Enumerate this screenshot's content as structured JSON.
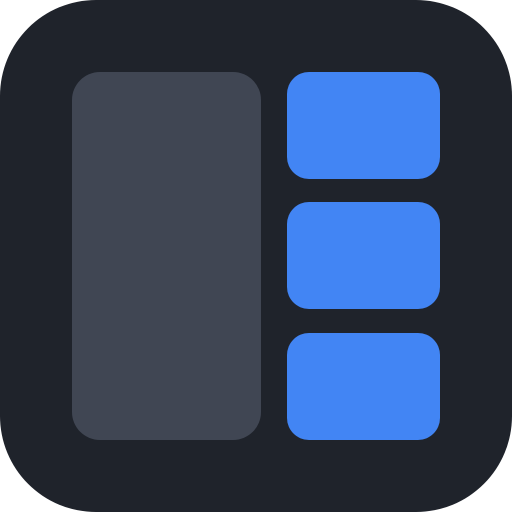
{
  "icon": {
    "name": "layout-panels-icon",
    "colors": {
      "background": "#1f232b",
      "large_panel": "#404653",
      "small_panel": "#4285f4"
    }
  }
}
